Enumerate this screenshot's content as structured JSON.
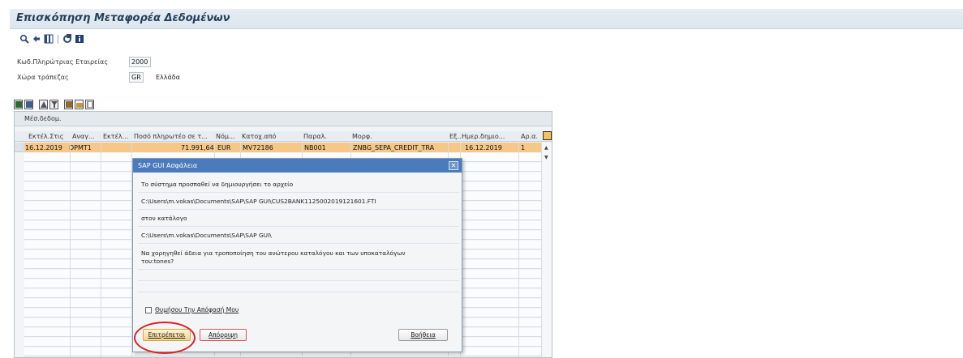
{
  "title": "Επισκόπηση Μεταφορέα Δεδομένων",
  "toolbar": {
    "icons": [
      "search-icon",
      "back-icon",
      "layout-icon",
      "refresh-icon",
      "info-icon"
    ]
  },
  "fields": [
    {
      "label": "Κωδ.Πληρώτριας Εταιρείας",
      "value": "2000",
      "desc": ""
    },
    {
      "label": "Χώρα τράπεζας",
      "value": "GR",
      "desc": "Ελλάδα"
    }
  ],
  "grid": {
    "title": "Μέσ.δεδομ.",
    "headers": [
      "Εκτέλ.Στις",
      "Αναγ...",
      "Εκτέλ...",
      "Ποσό πληρωτέο σε τ...",
      "Νόμ...",
      "Κατοχ.από",
      "Παραλ.",
      "Μορφ.",
      "Εξ...",
      "Ημερ.δημιο...",
      "Αρ.α."
    ],
    "row": [
      "16.12.2019",
      "DPMT1",
      "",
      "71.991,64",
      "EUR",
      "MV72186",
      "NB001",
      "ZNBG_SEPA_CREDIT_TRA",
      "",
      "16.12.2019",
      "1"
    ]
  },
  "dialog": {
    "title": "SAP GUI Ασφάλεια",
    "line1": "Το σύστημα προσπαθεί να δημιουργήσει το αρχείο",
    "path1": "C:\\Users\\m.vokas\\Documents\\SAP\\SAP GUI\\CUS2BANK1125002019121601.FTI",
    "line2": "στον κατάλογο",
    "path2": "C:\\Users\\m.vokas\\Documents\\SAP\\SAP GUI\\",
    "question1": "Να χορηγηθεί άδεια για τροποποίηση του ανώτερου καταλόγου και των υποκαταλόγων",
    "question2": "του:tones?",
    "checkbox": "Θυμήσου Την Απόφασή Μου",
    "allow": "Επιτρέπεται",
    "deny": "Απόρριψη",
    "help": "Βοήθεια"
  }
}
